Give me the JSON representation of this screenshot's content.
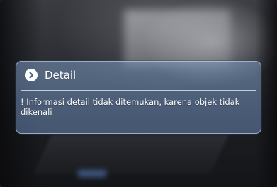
{
  "dialog": {
    "title": "Detail",
    "icon": "chevron-right-icon",
    "message": "! Informasi detail tidak ditemukan, karena objek tidak dikenali"
  },
  "colors": {
    "dialog_background": "#7d9bc3",
    "text": "#ffffff"
  }
}
